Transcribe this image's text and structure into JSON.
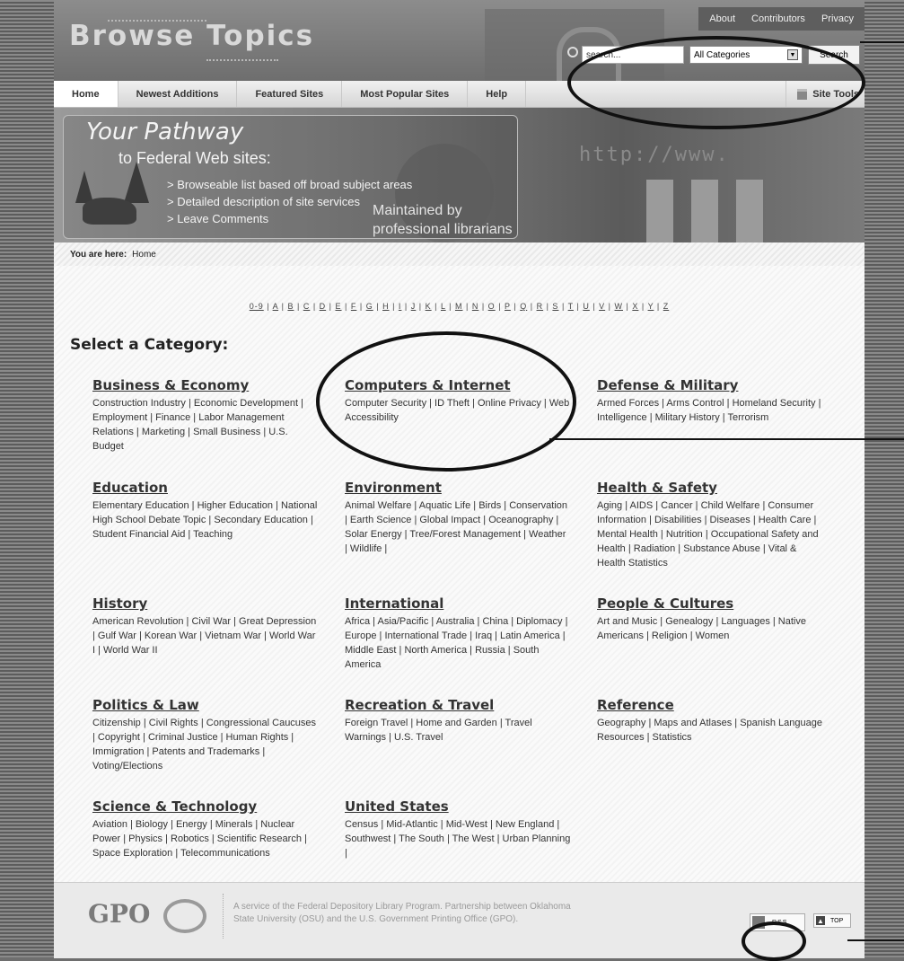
{
  "header": {
    "logo": "Browse Topics",
    "top_links": [
      "About",
      "Contributors",
      "Privacy"
    ],
    "search": {
      "placeholder": "search...",
      "category": "All Categories",
      "button": "Search"
    }
  },
  "nav": {
    "tabs": [
      "Home",
      "Newest Additions",
      "Featured Sites",
      "Most Popular Sites",
      "Help"
    ],
    "site_tools": "Site Tools"
  },
  "banner": {
    "title": "Your Pathway",
    "subtitle": "to Federal Web sites:",
    "bullets": [
      "> Browseable list based off broad subject areas",
      "> Detailed description of site services",
      "> Leave Comments"
    ],
    "maintained": "Maintained by professional librarians",
    "http": "http://www."
  },
  "breadcrumb": {
    "label": "You are here:",
    "current": "Home"
  },
  "alphabet": [
    "0-9",
    "A",
    "B",
    "C",
    "D",
    "E",
    "F",
    "G",
    "H",
    "I",
    "J",
    "K",
    "L",
    "M",
    "N",
    "O",
    "P",
    "Q",
    "R",
    "S",
    "T",
    "U",
    "V",
    "W",
    "X",
    "Y",
    "Z"
  ],
  "select_title": "Select a Category:",
  "categories": [
    {
      "title": "Business & Economy",
      "subs": "Construction Industry | Economic Development | Employment | Finance | Labor Management Relations | Marketing | Small Business | U.S. Budget"
    },
    {
      "title": "Computers & Internet",
      "subs": "Computer Security | ID Theft | Online Privacy | Web Accessibility"
    },
    {
      "title": "Defense & Military",
      "subs": "Armed Forces | Arms Control | Homeland Security | Intelligence | Military History | Terrorism"
    },
    {
      "title": "Education",
      "subs": "Elementary Education | Higher Education | National High School Debate Topic | Secondary Education | Student Financial Aid | Teaching"
    },
    {
      "title": "Environment",
      "subs": "Animal Welfare | Aquatic Life | Birds | Conservation | Earth Science | Global Impact | Oceanography | Solar Energy | Tree/Forest Management | Weather | Wildlife |"
    },
    {
      "title": "Health & Safety",
      "subs": "Aging | AIDS | Cancer | Child Welfare | Consumer Information | Disabilities | Diseases | Health Care | Mental Health | Nutrition | Occupational Safety and Health | Radiation | Substance Abuse | Vital & Health Statistics"
    },
    {
      "title": "History",
      "subs": "American Revolution | Civil War | Great Depression | Gulf War | Korean War | Vietnam War | World War I | World War II"
    },
    {
      "title": "International",
      "subs": "Africa | Asia/Pacific | Australia | China | Diplomacy | Europe | International Trade | Iraq | Latin America | Middle East | North America | Russia | South America"
    },
    {
      "title": "People & Cultures",
      "subs": "Art and Music | Genealogy | Languages | Native Americans | Religion | Women"
    },
    {
      "title": "Politics & Law",
      "subs": "Citizenship | Civil Rights | Congressional Caucuses | Copyright | Criminal Justice | Human Rights | Immigration | Patents and Trademarks | Voting/Elections"
    },
    {
      "title": "Recreation & Travel",
      "subs": "Foreign Travel | Home and Garden | Travel Warnings | U.S. Travel"
    },
    {
      "title": "Reference",
      "subs": "Geography | Maps and Atlases | Spanish Language Resources | Statistics"
    },
    {
      "title": "Science & Technology",
      "subs": "Aviation | Biology | Energy | Minerals | Nuclear Power | Physics | Robotics | Scientific Research | Space Exploration | Telecommunications"
    },
    {
      "title": "United States",
      "subs": "Census | Mid-Atlantic | Mid-West | New England | Southwest | The South | The West | Urban Planning |"
    }
  ],
  "footer": {
    "gpo": "GPO",
    "text": "A service of the Federal Depository Library Program. Partnership between Oklahoma State University (OSU) and the U.S. Government Printing Office (GPO).",
    "rss": "RSS",
    "top": "TOP"
  }
}
